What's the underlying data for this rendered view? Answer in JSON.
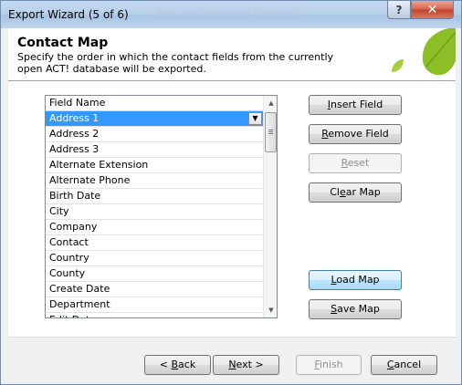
{
  "window": {
    "title": "Export Wizard (5 of 6)",
    "behind_title": "New and Improved Features",
    "help_label": "?",
    "close_label": "✕"
  },
  "header": {
    "title": "Contact Map",
    "description": "Specify the order in which the contact fields from the currently open ACT! database will be exported."
  },
  "list": {
    "column_header": "Field Name",
    "rows": [
      "Address 1",
      "Address 2",
      "Address 3",
      "Alternate Extension",
      "Alternate Phone",
      "Birth Date",
      "City",
      "Company",
      "Contact",
      "Country",
      "County",
      "Create Date",
      "Department",
      "Edit Date"
    ],
    "selected_index": 0
  },
  "side_buttons": {
    "insert": {
      "pre": "",
      "u": "I",
      "post": "nsert Field"
    },
    "remove": {
      "pre": "",
      "u": "R",
      "post": "emove Field"
    },
    "reset": {
      "pre": "",
      "u": "R",
      "post": "eset"
    },
    "clear": {
      "pre": "Cl",
      "u": "e",
      "post": "ar Map"
    },
    "load": {
      "pre": "",
      "u": "L",
      "post": "oad Map"
    },
    "save": {
      "pre": "",
      "u": "S",
      "post": "ave Map"
    }
  },
  "nav_buttons": {
    "back": {
      "pre": "< ",
      "u": "B",
      "post": "ack"
    },
    "next": {
      "pre": "",
      "u": "N",
      "post": "ext >"
    },
    "finish": {
      "pre": "",
      "u": "F",
      "post": "inish"
    },
    "cancel": {
      "pre": "",
      "u": "C",
      "post": "ancel"
    }
  },
  "colors": {
    "selection": "#3399ff",
    "leaf_green": "#8cbf26",
    "title_bar": "#b8d0ea"
  }
}
